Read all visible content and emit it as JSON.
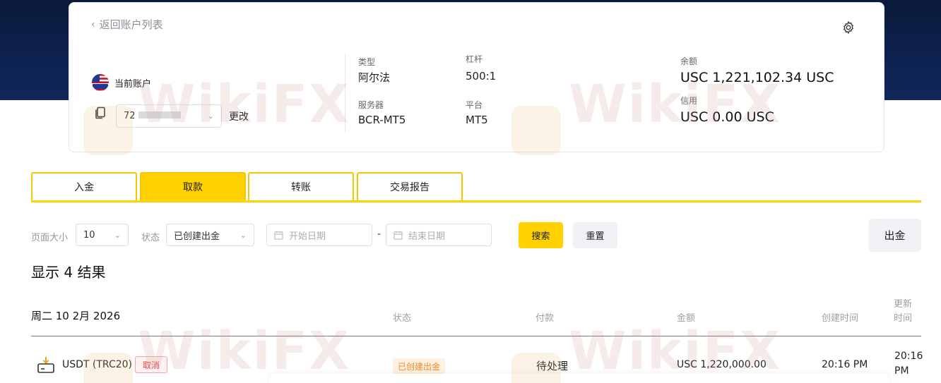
{
  "account": {
    "back_label": "返回账户列表",
    "current_label": "当前账户",
    "account_number_prefix": "72",
    "change_label": "更改",
    "type_label": "类型",
    "type_value": "阿尔法",
    "leverage_label": "杠杆",
    "leverage_value": "500:1",
    "server_label": "服务器",
    "server_value": "BCR-MT5",
    "platform_label": "平台",
    "platform_value": "MT5",
    "balance_label": "余额",
    "balance_value": "USC 1,221,102.34 USC",
    "credit_label": "信用",
    "credit_value": "USC 0.00 USC"
  },
  "tabs": [
    {
      "label": "入金",
      "active": false
    },
    {
      "label": "取款",
      "active": true
    },
    {
      "label": "转账",
      "active": false
    },
    {
      "label": "交易报告",
      "active": false
    }
  ],
  "filters": {
    "page_size_label": "页面大小",
    "page_size_value": "10",
    "status_label": "状态",
    "status_value": "已创建出金",
    "start_date_placeholder": "开始日期",
    "separator": "-",
    "end_date_placeholder": "结束日期",
    "search_label": "搜索",
    "reset_label": "重置",
    "withdraw_label": "出金"
  },
  "results": {
    "title": "显示 4 结果",
    "date_group": "周二 10 2月 2026",
    "columns": {
      "status": "状态",
      "payment": "付款",
      "amount": "金额",
      "created": "创建时间",
      "updated_line1": "更新",
      "updated_line2": "时间"
    },
    "rows": [
      {
        "method": "USDT (TRC20)",
        "tag": "取消",
        "status": "已创建出金",
        "payment": "待处理",
        "amount": "USC 1,220,000.00",
        "created": "20:16 PM",
        "updated_line1": "20:16",
        "updated_line2": "PM"
      }
    ]
  },
  "watermark": {
    "text": "WikiFX"
  },
  "colors": {
    "accent": "#ffd200",
    "header_bg": "#0e2250",
    "danger": "#e04b4b",
    "warning": "#f08a24"
  }
}
